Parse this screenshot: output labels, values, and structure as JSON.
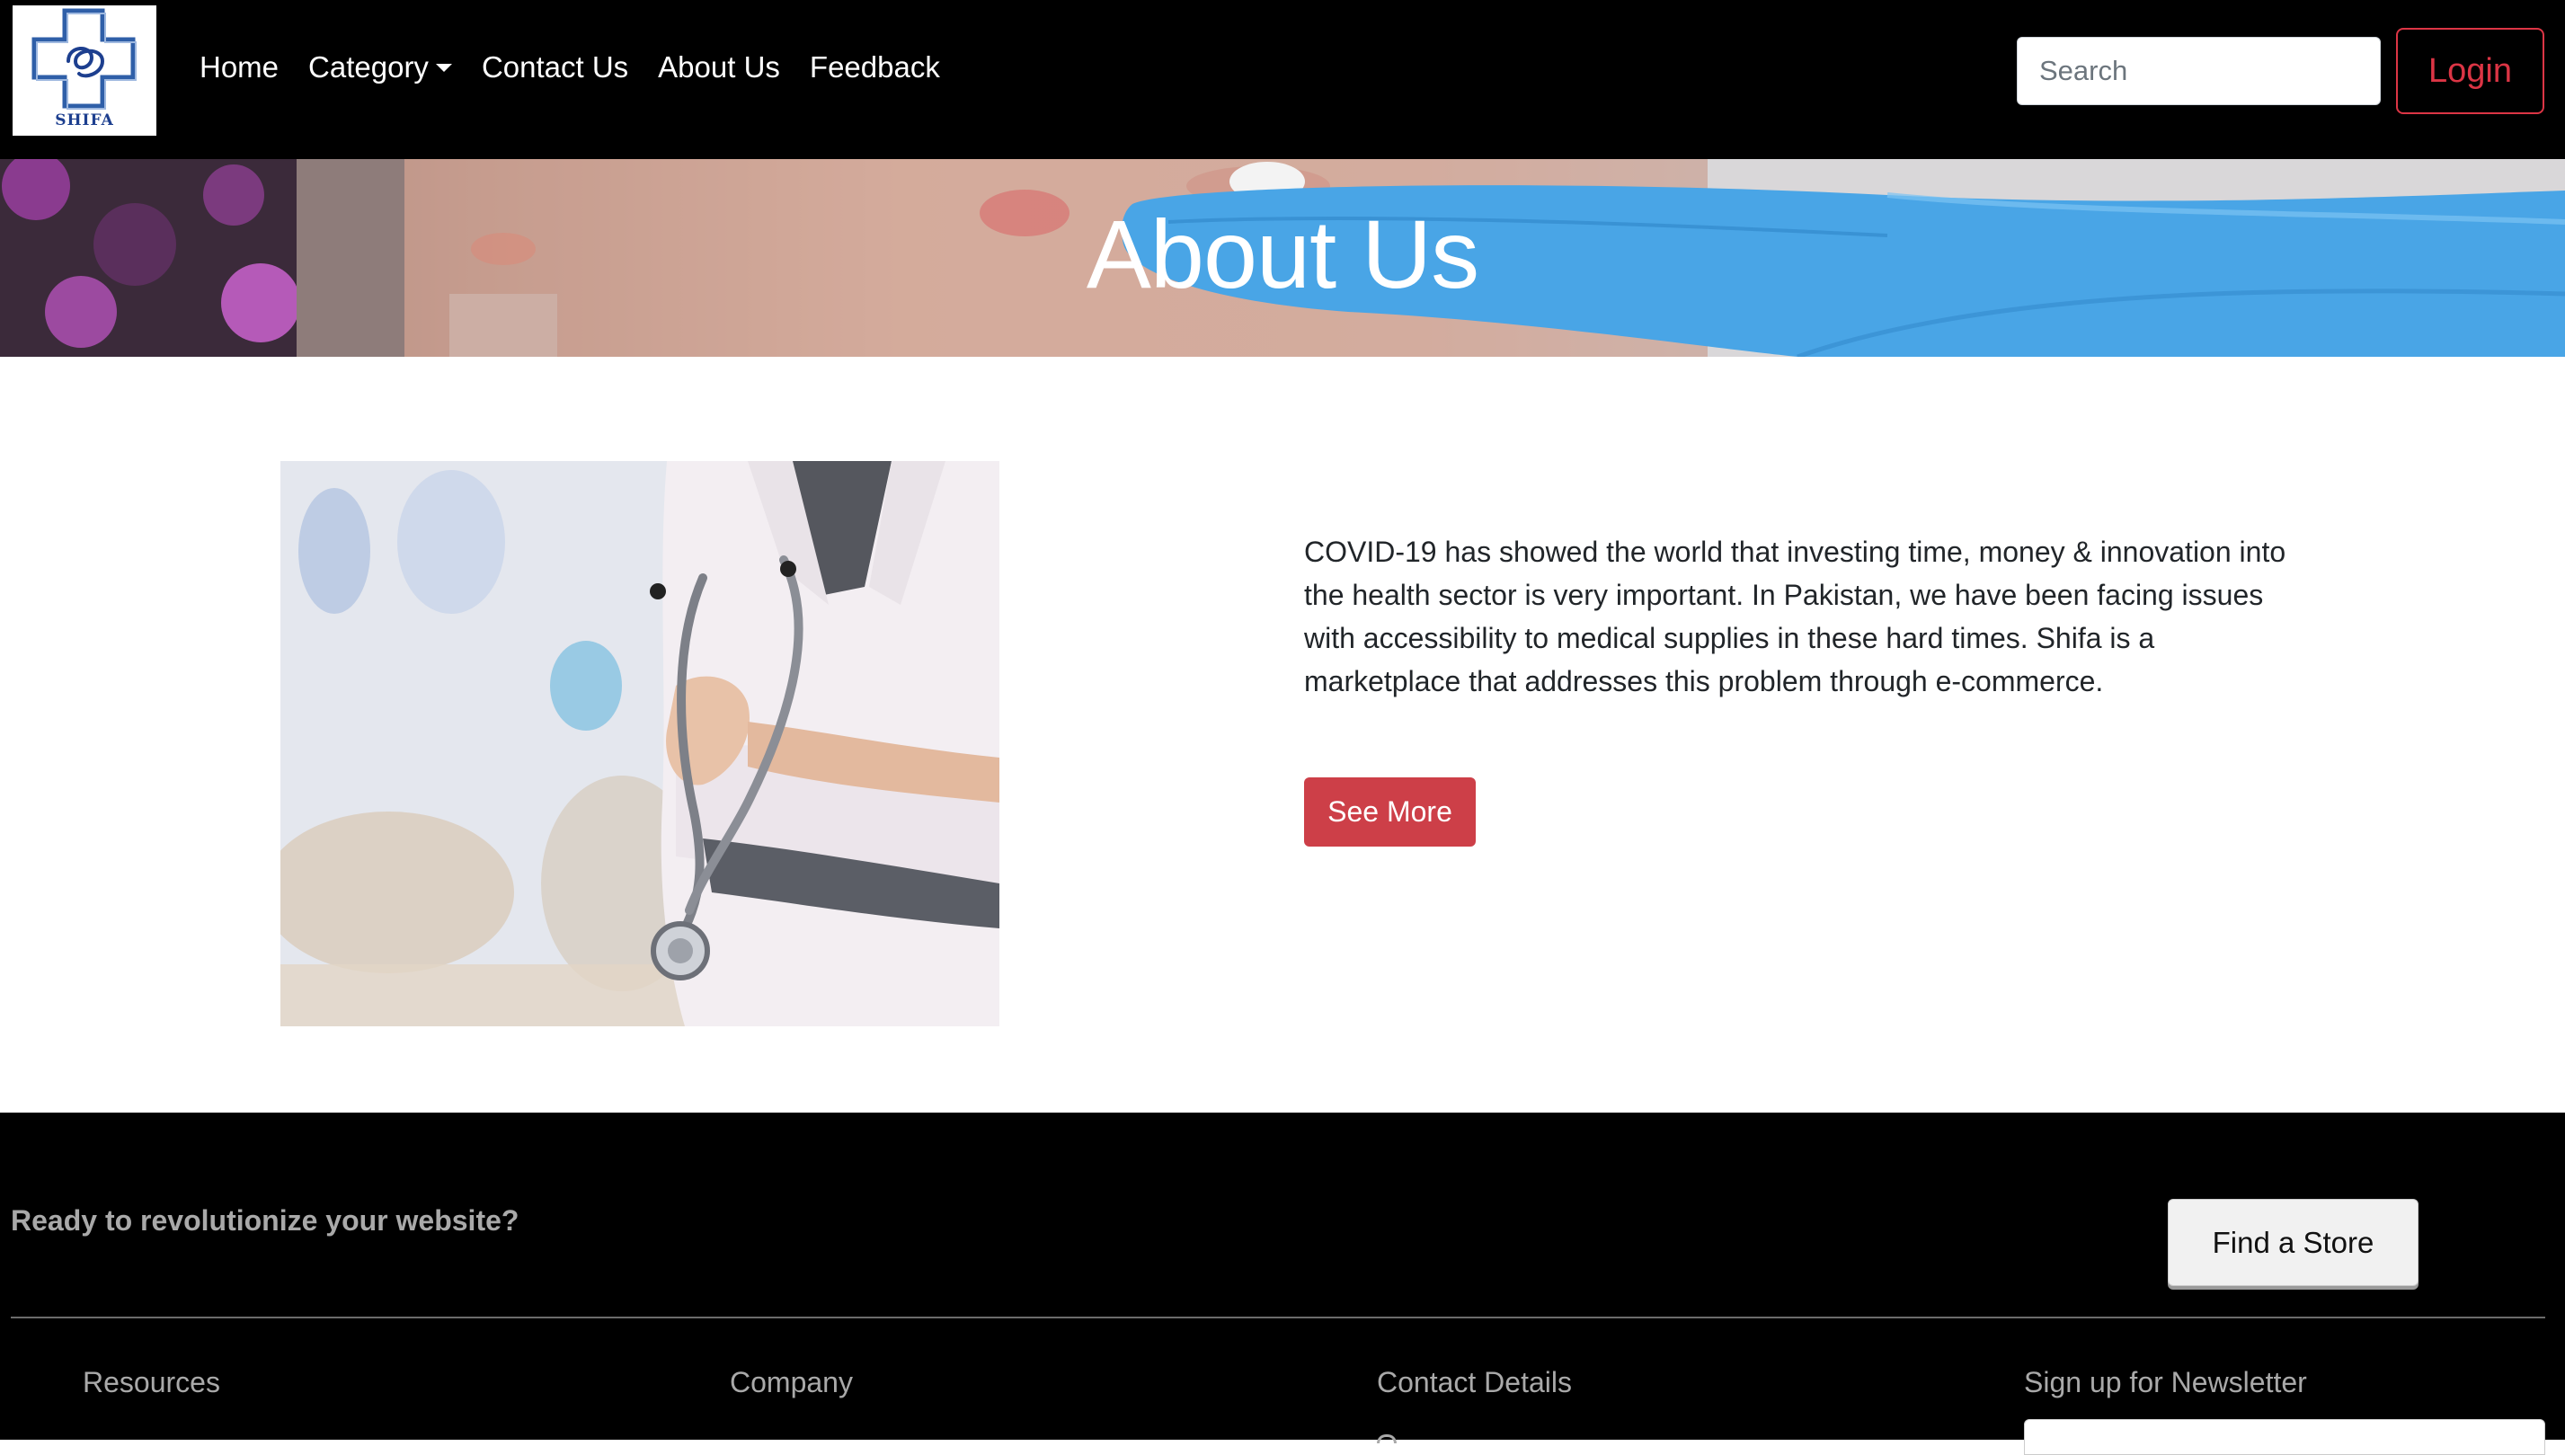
{
  "navbar": {
    "logo_text": "SHIFA",
    "links": [
      "Home",
      "Category",
      "Contact Us",
      "About Us",
      "Feedback"
    ],
    "search_placeholder": "Search",
    "login_label": "Login"
  },
  "hero": {
    "title": "About Us"
  },
  "about": {
    "text": "COVID-19 has showed the world that investing time, money & innovation into the health sector is very important. In Pakistan, we have been facing issues with accessibility to medical supplies in these hard times. Shifa is a marketplace that addresses this problem through e-commerce.",
    "see_more_label": "See More"
  },
  "footer": {
    "cta_text": "Ready to revolutionize your website?",
    "find_store_label": "Find a Store",
    "headings": [
      "Resources",
      "Company",
      "Contact Details",
      "Sign up for Newsletter"
    ]
  },
  "colors": {
    "navbar_bg": "#000000",
    "accent_red": "#dc3545",
    "see_more_bg": "#cd3f48",
    "footer_text": "#a9a9a9"
  }
}
